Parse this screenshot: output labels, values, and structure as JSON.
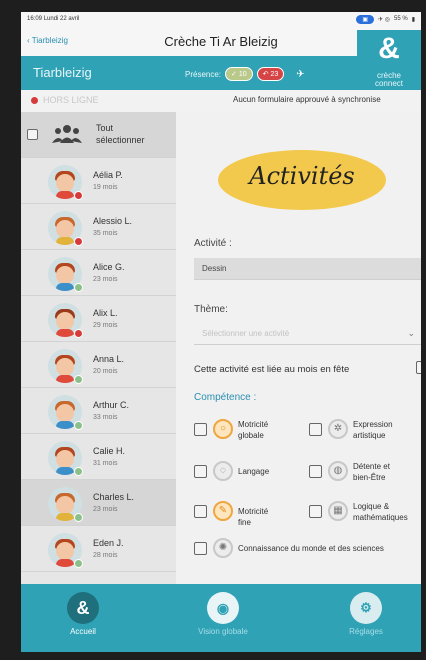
{
  "status_bar": {
    "time": "16:09",
    "date": "Lundi 22 avril",
    "battery": "55 %"
  },
  "nav": {
    "back_label": "Tiarbleizig",
    "title": "Crèche Ti Ar Bleizig"
  },
  "header": {
    "user_name": "Tiarbleizig",
    "presence_label": "Présence:",
    "present_count": "10",
    "absent_count": "23",
    "logo_text_line1": "crèche",
    "logo_text_line2": "connect"
  },
  "offline": {
    "status_text": "HORS LIGNE",
    "sync_message": "Aucun formulaire approuvé à synchronise"
  },
  "children_list": {
    "select_all_line1": "Tout",
    "select_all_line2": "sélectionner",
    "children": [
      {
        "name": "Aélia P.",
        "age": "19 mois",
        "status": "red",
        "hair": "#b4461f",
        "shirt": "#e04a3a"
      },
      {
        "name": "Alessio L.",
        "age": "35 mois",
        "status": "red",
        "hair": "#c9682c",
        "shirt": "#e2b33a"
      },
      {
        "name": "Alice G.",
        "age": "23 mois",
        "status": "green",
        "hair": "#b4461f",
        "shirt": "#3c8fc9"
      },
      {
        "name": "Alix L.",
        "age": "29 mois",
        "status": "red",
        "hair": "#9a3a1a",
        "shirt": "#e04a3a"
      },
      {
        "name": "Anna L.",
        "age": "20 mois",
        "status": "green",
        "hair": "#b4461f",
        "shirt": "#e04a3a"
      },
      {
        "name": "Arthur C.",
        "age": "33 mois",
        "status": "green",
        "hair": "#c9682c",
        "shirt": "#3c8fc9"
      },
      {
        "name": "Calie H.",
        "age": "31 mois",
        "status": "green",
        "hair": "#b4461f",
        "shirt": "#3c8fc9"
      },
      {
        "name": "Charles L.",
        "age": "23 mois",
        "status": "green",
        "hair": "#c9682c",
        "shirt": "#e2b33a"
      },
      {
        "name": "Eden J.",
        "age": "28 mois",
        "status": "green",
        "hair": "#b4461f",
        "shirt": "#e04a3a"
      }
    ]
  },
  "form": {
    "title": "Activités",
    "activity_label": "Activité :",
    "activity_value": "Dessin",
    "theme_label": "Thème:",
    "theme_placeholder": "Sélectionner une activité",
    "month_question": "Cette activité est liée au mois en fête",
    "competence_label": "Compétence :",
    "skills": {
      "motricite_globale": "Motricité globale",
      "expression_artistique": "Expression artistique",
      "langage": "Langage",
      "detente": "Détente et bien-Être",
      "motricite_fine": "Motricité fine",
      "logique": "Logique & mathématiques",
      "connaissance": "Connaissance du monde et des sciences"
    }
  },
  "tabbar": {
    "home": "Accueil",
    "overview": "Vision globale",
    "settings": "Réglages"
  },
  "colors": {
    "brand_teal": "#2fa2b6",
    "accent_yellow": "#f2c94c",
    "offline_red": "#d63b3b"
  }
}
